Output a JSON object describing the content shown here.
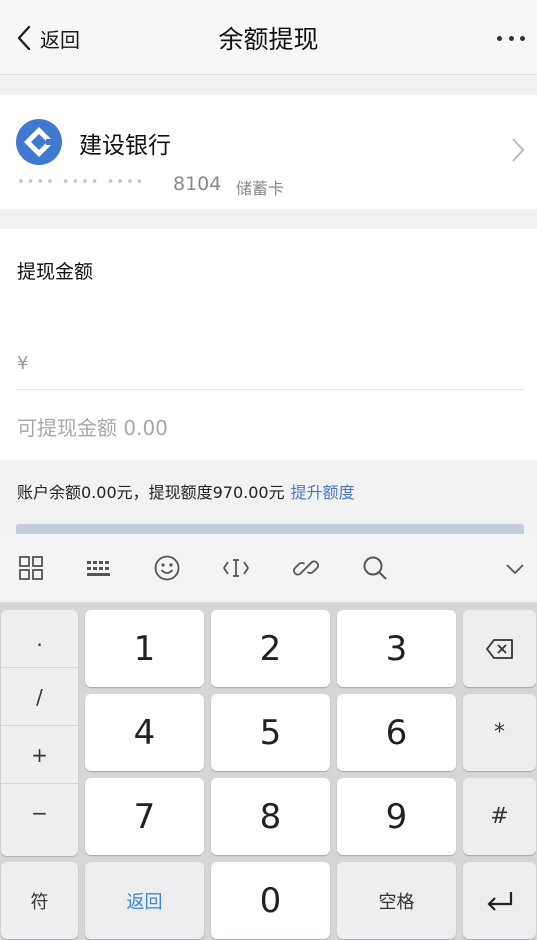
{
  "header": {
    "back_label": "返回",
    "title": "余额提现",
    "more_icon": "more-dots-icon"
  },
  "bank": {
    "name": "建设银行",
    "mask": "•••• •••• ••••",
    "last4": "8104",
    "card_type": "储蓄卡",
    "logo_color": "#3f79d1"
  },
  "amount": {
    "label": "提现金额",
    "currency": "¥",
    "value": "",
    "available": "可提现金额 0.00"
  },
  "balance": {
    "text": "账户余额0.00元，提现额度970.00元",
    "link": "提升额度"
  },
  "keyboard": {
    "toolbar": [
      "grid-icon",
      "keyboard-icon",
      "emoji-icon",
      "cursor-icon",
      "link-icon",
      "search-icon",
      "chevron-down-icon"
    ],
    "symbols": [
      ".",
      "/",
      "+",
      "−"
    ],
    "digits": [
      "1",
      "2",
      "3",
      "4",
      "5",
      "6",
      "7",
      "8",
      "9",
      "0"
    ],
    "delete_icon": "backspace-icon",
    "star": "*",
    "hash": "#",
    "symbol_key": "符",
    "back_key": "返回",
    "space_key": "空格",
    "enter_icon": "enter-icon",
    "accent": "#3a88cf"
  }
}
